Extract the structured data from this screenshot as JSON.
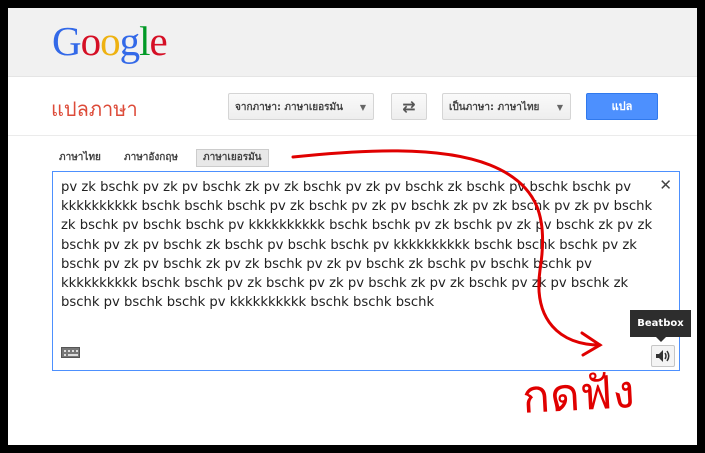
{
  "logo": {
    "letters": [
      "G",
      "o",
      "o",
      "g",
      "l",
      "e"
    ],
    "colors": [
      "#3369e8",
      "#d50f25",
      "#eeb211",
      "#3369e8",
      "#009925",
      "#d50f25"
    ]
  },
  "app": {
    "title": "แปลภาษา"
  },
  "toolbar": {
    "source_select": "จากภาษา: ภาษาเยอรมัน",
    "target_select": "เป็นภาษา: ภาษาไทย",
    "translate_label": "แปล"
  },
  "lang_tabs": [
    "ภาษาไทย",
    "ภาษาอังกฤษ",
    "ภาษาเยอรมัน"
  ],
  "input": {
    "text": "pv zk bschk pv zk pv bschk zk pv zk bschk pv zk pv bschk zk bschk pv bschk bschk pv kkkkkkkkkk bschk bschk bschk pv zk bschk pv zk pv bschk zk pv zk bschk pv zk pv bschk zk bschk pv bschk bschk pv kkkkkkkkkk bschk bschk pv zk bschk pv zk pv bschk zk pv zk bschk pv zk pv bschk zk bschk pv bschk bschk pv kkkkkkkkkk bschk bschk bschk pv zk bschk pv zk pv bschk zk pv zk bschk pv zk pv bschk zk bschk pv bschk bschk pv kkkkkkkkkk bschk bschk pv zk bschk pv zk pv bschk zk pv zk bschk pv zk pv bschk zk bschk pv bschk bschk pv kkkkkkkkkk bschk bschk bschk"
  },
  "tooltip": "Beatbox",
  "annotation": {
    "text": "กดฟัง",
    "color": "#e00000"
  },
  "icons": {
    "clear": "close-icon",
    "keyboard": "keyboard-icon",
    "listen": "speaker-icon",
    "swap": "swap-languages-icon"
  }
}
